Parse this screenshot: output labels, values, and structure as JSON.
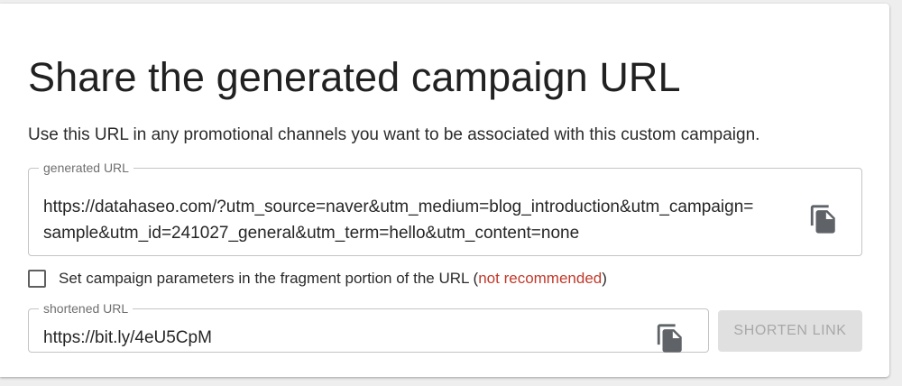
{
  "card": {
    "title": "Share the generated campaign URL",
    "description": "Use this URL in any promotional channels you want to be associated with this custom campaign."
  },
  "generated_url": {
    "label": "generated URL",
    "value": "https://datahaseo.com/?utm_source=naver&utm_medium=blog_introduction&utm_campaign=\nsample&utm_id=241027_general&utm_term=hello&utm_content=none",
    "copy_icon": "copy-icon"
  },
  "fragment_option": {
    "checked": false,
    "label_prefix": "Set campaign parameters in the fragment portion of the URL (",
    "label_warning": "not recommended",
    "label_suffix": ")",
    "warning_color": "#c0392b"
  },
  "shortened_url": {
    "label": "shortened URL",
    "value": "https://bit.ly/4eU5CpM",
    "copy_icon": "copy-icon"
  },
  "shorten_button": {
    "label": "SHORTEN LINK",
    "disabled": true
  }
}
